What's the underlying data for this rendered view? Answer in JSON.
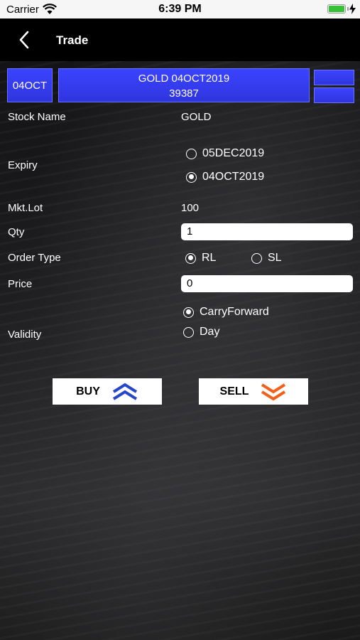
{
  "status_bar": {
    "carrier": "Carrier",
    "time": "6:39 PM"
  },
  "nav": {
    "title": "Trade"
  },
  "header": {
    "expiry_short": "04OCT",
    "symbol": "GOLD 04OCT2019",
    "price": "39387"
  },
  "form": {
    "stock_name_label": "Stock Name",
    "stock_name_value": "GOLD",
    "expiry_label": "Expiry",
    "expiry_options": [
      {
        "label": "05DEC2019",
        "selected": false
      },
      {
        "label": "04OCT2019",
        "selected": true
      }
    ],
    "mkt_lot_label": "Mkt.Lot",
    "mkt_lot_value": "100",
    "qty_label": "Qty",
    "qty_value": "1",
    "order_type_label": "Order Type",
    "order_type_options": [
      {
        "label": "RL",
        "selected": true
      },
      {
        "label": "SL",
        "selected": false
      }
    ],
    "price_label": "Price",
    "price_value": "0",
    "validity_label": "Validity",
    "validity_options": [
      {
        "label": "CarryForward",
        "selected": true
      },
      {
        "label": "Day",
        "selected": false
      }
    ]
  },
  "actions": {
    "buy_label": "BUY",
    "sell_label": "SELL"
  },
  "colors": {
    "accent_blue": "#3b44ff",
    "buy_arrow": "#2746c9",
    "sell_arrow": "#f2601a"
  }
}
